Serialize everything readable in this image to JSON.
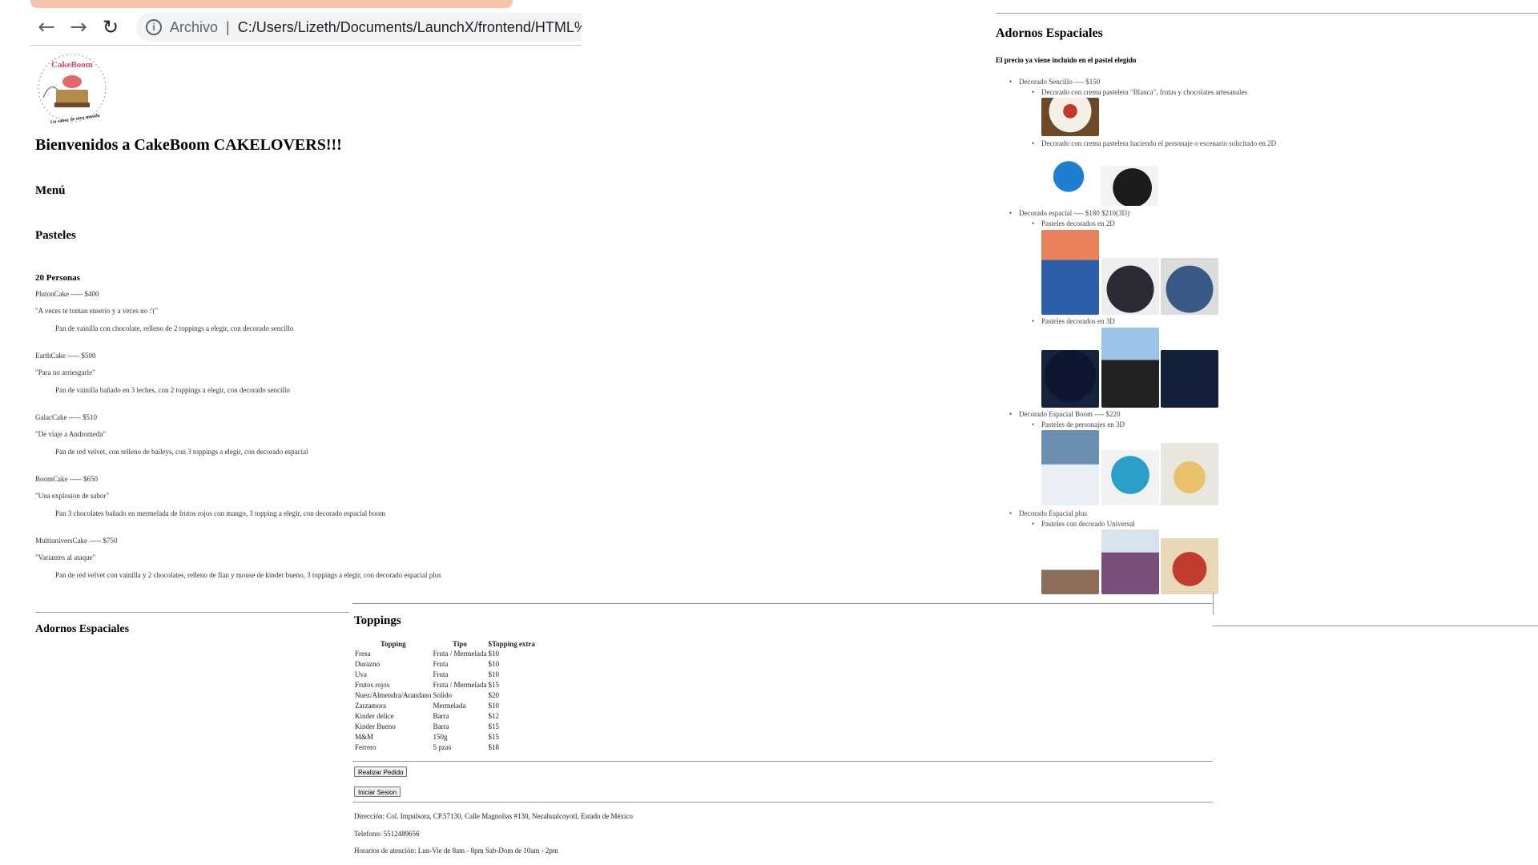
{
  "browser": {
    "back_icon": "arrow-left-icon",
    "forward_icon": "arrow-right-icon",
    "reload_icon": "reload-icon",
    "address_scheme": "Archivo",
    "address_path": "C:/Users/Lizeth/Documents/LaunchX/frontend/HTML%"
  },
  "logo": {
    "brand_text": "CakeBoom",
    "tagline": "Un sabor de otro mundo"
  },
  "header": {
    "welcome": "Bienvenidos a CakeBoom CAKELOVERS!!!"
  },
  "menu": {
    "title": "Menú",
    "pasteles_title": "Pasteles",
    "section_title": "20 Personas"
  },
  "cakes": [
    {
      "name_price": "PlutonCake ----- $400",
      "slogan": "\"A veces te toman enserio y a veces no :'(\"",
      "description": "Pan de vainilla con chocolate, relleno de 2 toppings a elegir, con decorado sencillo"
    },
    {
      "name_price": "EarthCake ----- $500",
      "slogan": "\"Para no arriesgarle\"",
      "description": "Pan de vainilla bañado en 3 leches, con 2 toppings a elegir, con decorado sencillo"
    },
    {
      "name_price": "GalacCake ----- $510",
      "slogan": "\"De viaje a Andromeda\"",
      "description": "Pan de red velvet, con relleno de baileys, con 3 toppings a elegir, con decorado espacial"
    },
    {
      "name_price": "BoomCake ----- $650",
      "slogan": "\"Una explosion de sabor\"",
      "description": "Pan 3 chocolates bañado en mermelada de frutos rojos con mango, 3 topping a elegir, con decorado espacial boom"
    },
    {
      "name_price": "MultiuniversCake ----- $750",
      "slogan": "\"Variantes al ataque\"",
      "description": "Pan de red velvet con vainilla y 2 chocolates, relleno de flan y mouse de kinder bueno, 3 toppings a elegir, con decorado espacial plus"
    }
  ],
  "adornos_left": {
    "title": "Adornos Espaciales"
  },
  "toppings": {
    "title": "Toppings",
    "headers": [
      "Topping",
      "Tipo",
      "$Topping extra"
    ],
    "rows": [
      [
        "Fresa",
        "Fruta / Mermelada",
        "$10"
      ],
      [
        "Durazno",
        "Fruta",
        "$10"
      ],
      [
        "Uva",
        "Fruta",
        "$10"
      ],
      [
        "Frutos rojos",
        "Fruta / Mermelada",
        "$15"
      ],
      [
        "Nuez/Almendra/Arandano",
        "Solido",
        "$20"
      ],
      [
        "Zarzamora",
        "Mermelada",
        "$10"
      ],
      [
        "Kinder delice",
        "Barra",
        "$12"
      ],
      [
        "Kinder Bueno",
        "Barra",
        "$15"
      ],
      [
        "M&M",
        "150g",
        "$15"
      ],
      [
        "Ferrero",
        "5 pzas",
        "$18"
      ]
    ]
  },
  "actions": {
    "order_button": "Realizar Pedido",
    "login_button": "Iniciar Sesion"
  },
  "footer": {
    "address": "Dirección: Col. Impulsora, CP.57130, Calle Magnolias #130, Nezahualcoyotl, Estado de México",
    "phone": "Telefono: 5512489656",
    "hours": "Horarios de atención: Lun-Vie de 8am - 8pm Sab-Dom de 10am - 2pm"
  },
  "adornos_right": {
    "title": "Adornos Espaciales",
    "note": "El precio ya viene incluido en el pastel elegido",
    "items": [
      {
        "label": "Decorado Sencillo ---- $150",
        "subs": [
          "Decorado con crema pastelera \"Blanca\", frutas y chocolates artesanales",
          "Decorado con crema pastelera haciendo el personaje o escenario solicitado en 2D"
        ]
      },
      {
        "label": "Decorado espacial ---- $180 $210(3D)",
        "subs": [
          "Pasteles decorados en 2D",
          "Pasteles decorados en 3D"
        ]
      },
      {
        "label": "Decorado Espacial Boom ---- $220",
        "subs": [
          "Pasteles de personajes en 3D"
        ]
      },
      {
        "label": "Decorado Espacial plus",
        "subs": [
          "Pasteles con decorado Universal"
        ]
      }
    ]
  }
}
